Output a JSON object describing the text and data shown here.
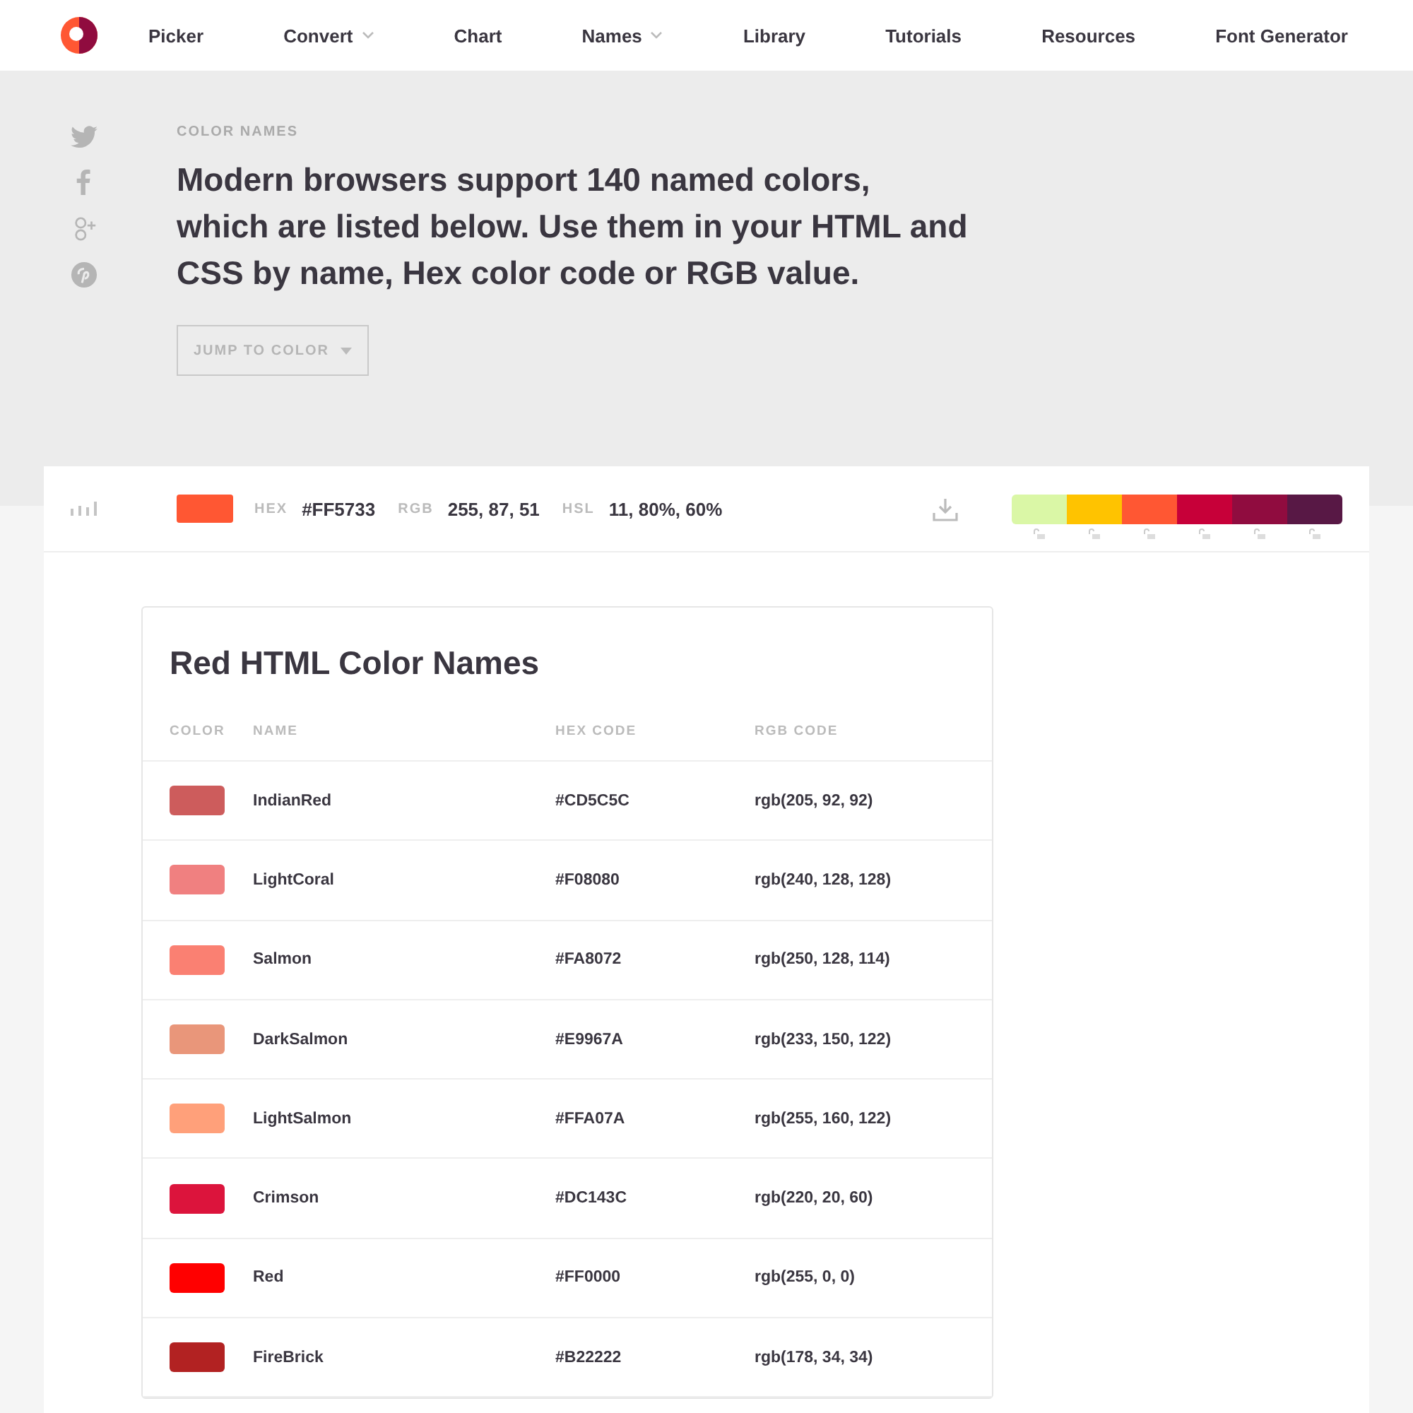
{
  "nav": {
    "items": [
      {
        "label": "Picker",
        "has_menu": false
      },
      {
        "label": "Convert",
        "has_menu": true
      },
      {
        "label": "Chart",
        "has_menu": false
      },
      {
        "label": "Names",
        "has_menu": true
      },
      {
        "label": "Library",
        "has_menu": false
      },
      {
        "label": "Tutorials",
        "has_menu": false
      },
      {
        "label": "Resources",
        "has_menu": false
      },
      {
        "label": "Font Generator",
        "has_menu": false
      }
    ]
  },
  "hero": {
    "eyebrow": "COLOR NAMES",
    "headline": "Modern browsers support 140 named colors, which are listed below. Use them in your HTML and CSS by name, Hex color code or RGB value.",
    "jump_button": "JUMP TO COLOR"
  },
  "color_bar": {
    "hex_label": "HEX",
    "hex": "#FF5733",
    "rgb_label": "RGB",
    "rgb": "255, 87, 51",
    "hsl_label": "HSL",
    "hsl": "11, 80%, 60%",
    "palette": [
      {
        "color": "#daf7a6"
      },
      {
        "color": "#ffc300"
      },
      {
        "color": "#ff5733"
      },
      {
        "color": "#c70039"
      },
      {
        "color": "#900c3f"
      },
      {
        "color": "#581845"
      }
    ]
  },
  "table": {
    "title": "Red HTML Color Names",
    "columns": [
      "COLOR",
      "NAME",
      "HEX CODE",
      "RGB CODE"
    ],
    "rows": [
      {
        "color": "#cd5c5c",
        "name": "IndianRed",
        "hex": "#CD5C5C",
        "rgb": "rgb(205, 92, 92)"
      },
      {
        "color": "#f08080",
        "name": "LightCoral",
        "hex": "#F08080",
        "rgb": "rgb(240, 128, 128)"
      },
      {
        "color": "#fa8072",
        "name": "Salmon",
        "hex": "#FA8072",
        "rgb": "rgb(250, 128, 114)"
      },
      {
        "color": "#e9967a",
        "name": "DarkSalmon",
        "hex": "#E9967A",
        "rgb": "rgb(233, 150, 122)"
      },
      {
        "color": "#ffa07a",
        "name": "LightSalmon",
        "hex": "#FFA07A",
        "rgb": "rgb(255, 160, 122)"
      },
      {
        "color": "#dc143c",
        "name": "Crimson",
        "hex": "#DC143C",
        "rgb": "rgb(220, 20, 60)"
      },
      {
        "color": "#ff0000",
        "name": "Red",
        "hex": "#FF0000",
        "rgb": "rgb(255, 0, 0)"
      },
      {
        "color": "#b22222",
        "name": "FireBrick",
        "hex": "#B22222",
        "rgb": "rgb(178, 34, 34)"
      }
    ]
  }
}
